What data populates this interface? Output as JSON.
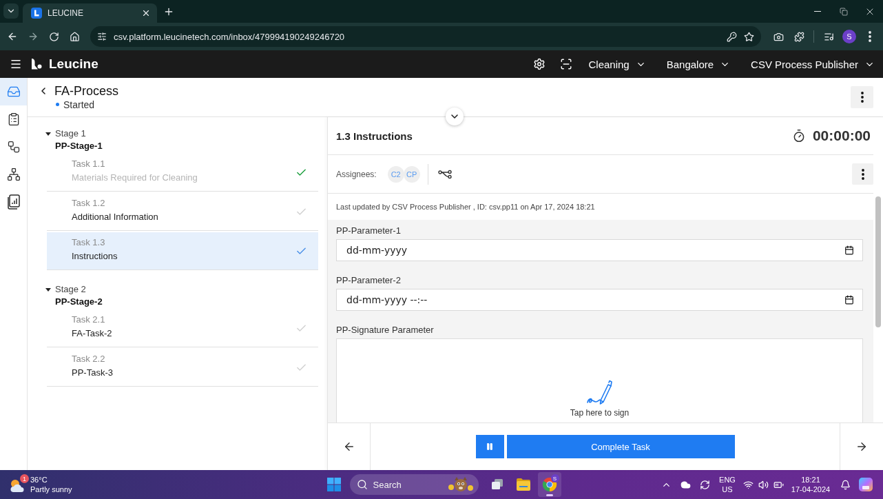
{
  "browser": {
    "tab_title": "LEUCINE",
    "url": "csv.platform.leucinetech.com/inbox/479994190249246720",
    "profile_initial": "S"
  },
  "app_header": {
    "logo_text": "Leucine",
    "dropdowns": [
      {
        "label": "Cleaning"
      },
      {
        "label": "Bangalore"
      },
      {
        "label": "CSV Process Publisher"
      }
    ]
  },
  "nav_rail": [
    {
      "kind": "inbox",
      "selected": true
    },
    {
      "kind": "checklist",
      "selected": false
    },
    {
      "kind": "flow",
      "selected": false
    },
    {
      "kind": "hierarchy",
      "selected": false
    },
    {
      "kind": "report",
      "selected": false
    }
  ],
  "process": {
    "title": "FA-Process",
    "status": "Started"
  },
  "stages": [
    {
      "label": "Stage 1",
      "name": "PP-Stage-1",
      "expanded": true,
      "tasks": [
        {
          "number": "Task 1.1",
          "name": "Materials Required for Cleaning",
          "completed": true,
          "selected": false
        },
        {
          "number": "Task 1.2",
          "name": "Additional Information",
          "completed": false,
          "selected": false
        },
        {
          "number": "Task 1.3",
          "name": "Instructions",
          "completed": false,
          "selected": true
        }
      ]
    },
    {
      "label": "Stage 2",
      "name": "PP-Stage-2",
      "expanded": true,
      "tasks": [
        {
          "number": "Task 2.1",
          "name": "FA-Task-2",
          "completed": false,
          "selected": false
        },
        {
          "number": "Task 2.2",
          "name": "PP-Task-3",
          "completed": false,
          "selected": false
        }
      ]
    }
  ],
  "task_panel": {
    "title": "1.3 Instructions",
    "timer": "00:00:00",
    "assignees_label": "Assignees:",
    "assignees": [
      {
        "initials": "C2"
      },
      {
        "initials": "CP"
      }
    ],
    "last_updated": "Last updated by CSV Process Publisher , ID: csv.pp11 on Apr 17, 2024 18:21",
    "parameters": [
      {
        "kind": "date",
        "label": "PP-Parameter-1",
        "placeholder": "dd-mm-yyyy"
      },
      {
        "kind": "datetime",
        "label": "PP-Parameter-2",
        "placeholder": "dd-mm-yyyy --:--"
      },
      {
        "kind": "signature",
        "label": "PP-Signature Parameter",
        "hint": "Tap here to sign"
      }
    ]
  },
  "footer": {
    "action": "Complete Task"
  },
  "taskbar": {
    "weather": {
      "temperature": "36°C",
      "condition": "Partly sunny",
      "alert_count": "1"
    },
    "search_label": "Search",
    "browser_badge": "S",
    "language": "ENG",
    "region": "US",
    "time": "18:21",
    "date": "17-04-2024"
  }
}
